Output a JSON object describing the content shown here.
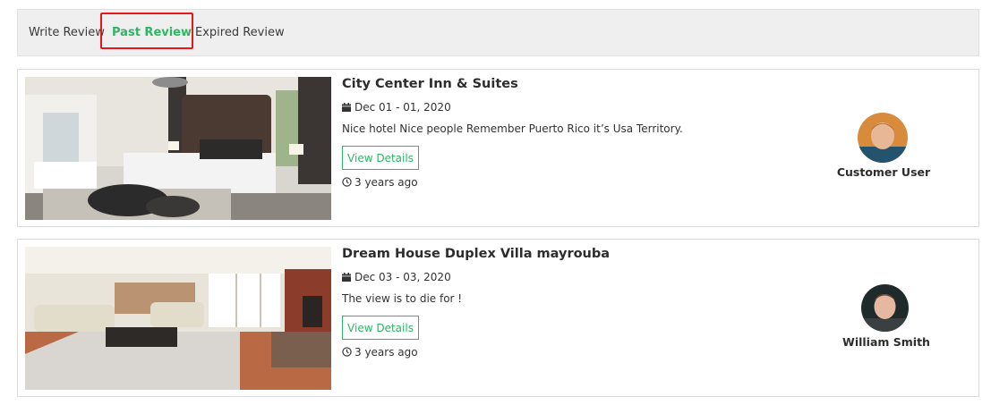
{
  "tabs": [
    {
      "label": "Write Review",
      "active": false
    },
    {
      "label": "Past Review",
      "active": true
    },
    {
      "label": "Expired Review",
      "active": false
    }
  ],
  "colors": {
    "accent": "#2fb566",
    "highlight_border": "#e3191c"
  },
  "reviews": [
    {
      "hotel": "City Center Inn & Suites",
      "date_range": "Dec 01 - 01, 2020",
      "comment": "Nice hotel Nice people Remember Puerto Rico it’s Usa Territory.",
      "button_label": "View Details",
      "time_ago": "3 years ago",
      "user_name": "Customer User",
      "image": "bedroom-photo"
    },
    {
      "hotel": "Dream House Duplex Villa mayrouba",
      "date_range": "Dec 03 - 03, 2020",
      "comment": "The view is to die for !",
      "button_label": "View Details",
      "time_ago": "3 years ago",
      "user_name": "William Smith",
      "image": "living-room-photo"
    }
  ]
}
